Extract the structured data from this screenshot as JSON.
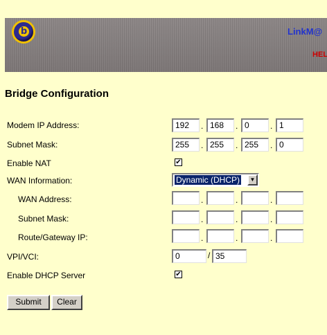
{
  "header": {
    "brand": "LinkM@",
    "help": "HEL"
  },
  "page_title": "Bridge Configuration",
  "labels": {
    "modem_ip": "Modem IP Address:",
    "subnet_mask": "Subnet Mask:",
    "enable_nat": "Enable NAT",
    "wan_info": "WAN Information:",
    "wan_address": "WAN Address:",
    "wan_subnet": "Subnet Mask:",
    "route_gw": "Route/Gateway IP:",
    "vpi_vci": "VPI/VCI:",
    "enable_dhcp": "Enable DHCP Server"
  },
  "fields": {
    "modem_ip": [
      "192",
      "168",
      "0",
      "1"
    ],
    "subnet_mask": [
      "255",
      "255",
      "255",
      "0"
    ],
    "wan_address": [
      "",
      "",
      "",
      ""
    ],
    "wan_subnet": [
      "",
      "",
      "",
      ""
    ],
    "route_gw": [
      "",
      "",
      "",
      ""
    ],
    "vpi": "0",
    "vci": "35",
    "wan_type": "Dynamic (DHCP)",
    "enable_nat": true,
    "enable_dhcp": true
  },
  "separators": {
    "dot": ".",
    "slash": "/"
  },
  "icons": {
    "check": "✔",
    "dropdown": "▼",
    "logo_letter": "b"
  },
  "buttons": {
    "submit": "Submit",
    "clear": "Clear"
  },
  "colors": {
    "page_bg": "#ffffcc",
    "brand": "#2233cc",
    "help": "#cc0000",
    "selected": "#0a246a"
  }
}
